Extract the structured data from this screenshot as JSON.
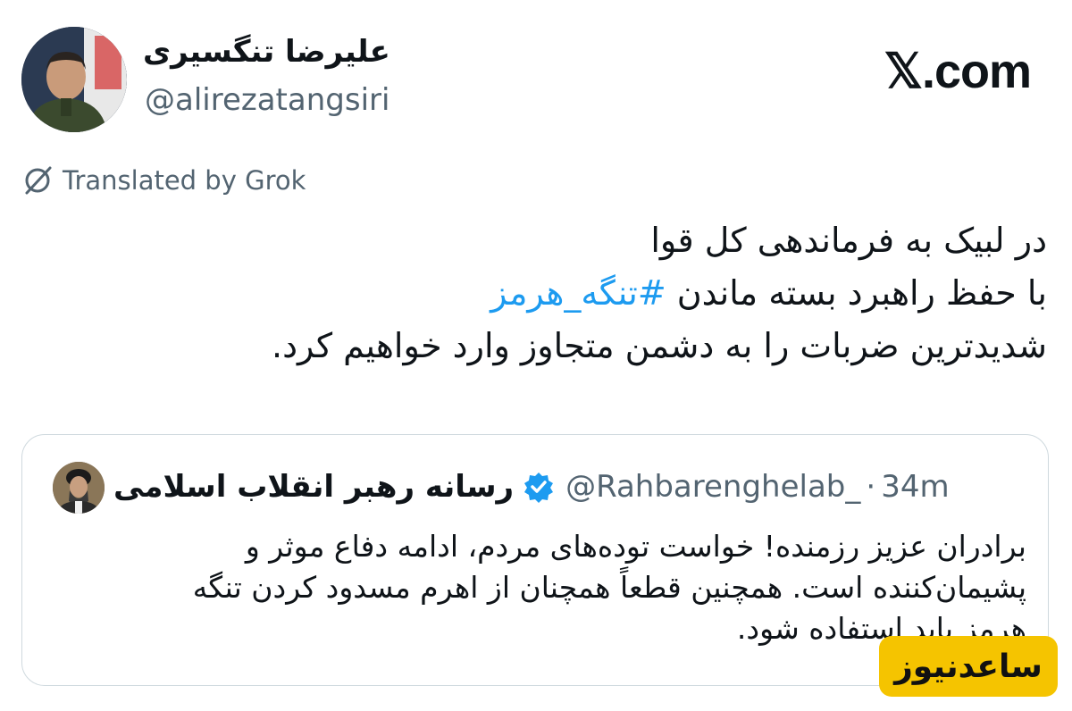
{
  "author": {
    "name": "علیرضا تنگسیری",
    "handle": "@alirezatangsiri"
  },
  "logo": {
    "text": "𝕏.com",
    "icon": "x-logo"
  },
  "translation": {
    "label": "Translated by Grok",
    "icon": "translate-off-icon"
  },
  "tweet": {
    "line1": "در لبیک به فرماندهی کل قوا",
    "line2_prefix": "با حفظ راهبرد بسته ماندن ",
    "hashtag": "#تنگه_هرمز",
    "line3": "شدیدترین ضربات را  به دشمن متجاوز وارد خواهیم کرد."
  },
  "quote": {
    "name": "رسانه رهبر انقلاب اسلامی",
    "verified_icon": "verified-badge-icon",
    "handle": "@Rahbarenghelab_",
    "separator": "·",
    "time": "34m",
    "text_line1": "برادران عزیز رزمنده! خواست توده‌های مردم، ادامه دفاع موثر و",
    "text_line2": "پشیمان‌کننده است. همچنین قطعاً همچنان از اهرم مسدود کردن تنگه",
    "text_line3": "هرمز باید استفاده شود."
  },
  "watermark": {
    "text": "ساعدنیوز"
  },
  "colors": {
    "accent": "#1d9bf0",
    "secondary_text": "#536471",
    "border": "#cfd9de",
    "watermark_bg": "#f5c400"
  }
}
